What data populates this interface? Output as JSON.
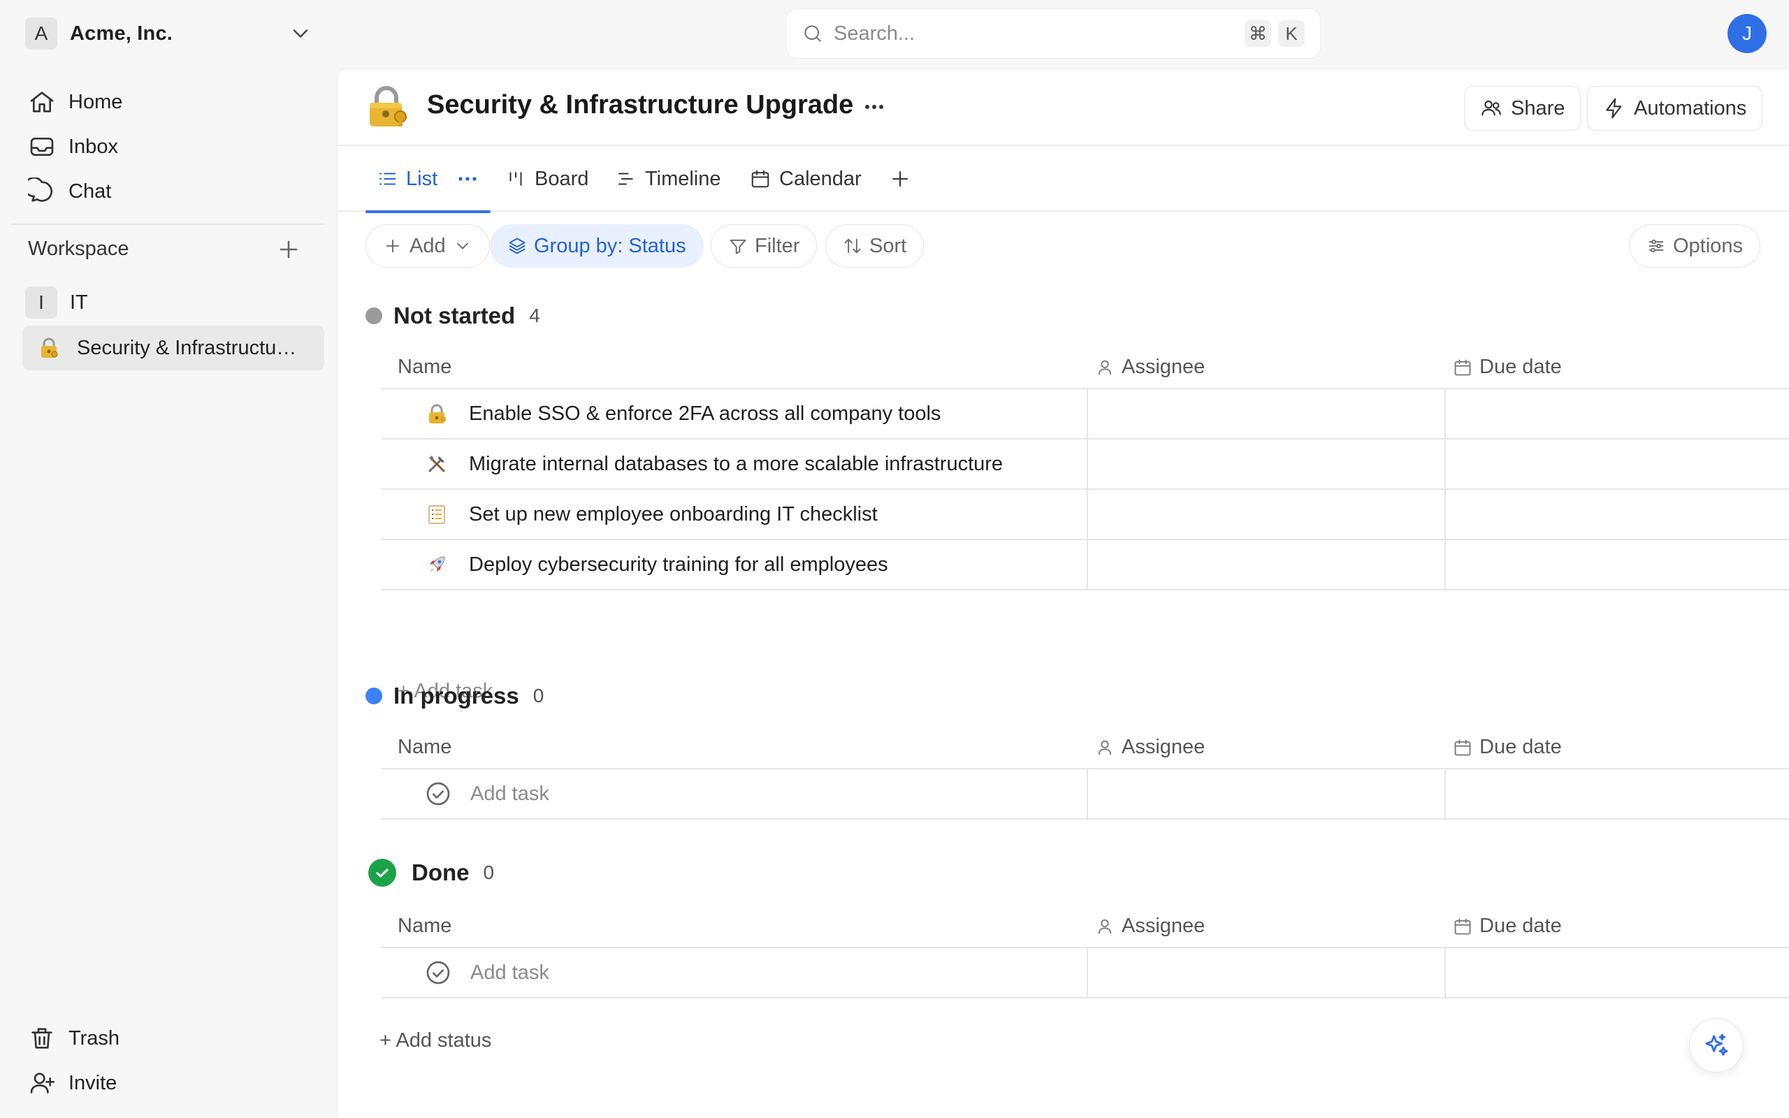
{
  "org": {
    "badge": "A",
    "name": "Acme, Inc."
  },
  "search": {
    "placeholder": "Search...",
    "shortcut_cmd": "⌘",
    "shortcut_key": "K"
  },
  "user": {
    "initial": "J"
  },
  "sidebar": {
    "nav": [
      {
        "label": "Home",
        "icon": "home-icon"
      },
      {
        "label": "Inbox",
        "icon": "inbox-icon"
      },
      {
        "label": "Chat",
        "icon": "chat-icon"
      }
    ],
    "workspace_title": "Workspace",
    "team": {
      "badge": "I",
      "label": "IT"
    },
    "project": {
      "label": "Security & Infrastructure Upgrade",
      "icon": "lock-key-icon"
    },
    "bottom": [
      {
        "label": "Trash",
        "icon": "trash-icon"
      },
      {
        "label": "Invite",
        "icon": "user-plus-icon"
      }
    ]
  },
  "page": {
    "title": "Security & Infrastructure Upgrade",
    "share_label": "Share",
    "automations_label": "Automations"
  },
  "tabs": [
    {
      "label": "List",
      "icon": "list-icon",
      "active": true
    },
    {
      "label": "Board",
      "icon": "board-icon"
    },
    {
      "label": "Timeline",
      "icon": "timeline-icon"
    },
    {
      "label": "Calendar",
      "icon": "calendar-icon"
    }
  ],
  "toolbar": {
    "add_label": "Add",
    "group_label": "Group by: Status",
    "filter_label": "Filter",
    "sort_label": "Sort",
    "options_label": "Options"
  },
  "columns": {
    "name": "Name",
    "assignee": "Assignee",
    "due_date": "Due date"
  },
  "groups": [
    {
      "title": "Not started",
      "count": "4",
      "color": "#9a9a9a",
      "tasks": [
        {
          "emoji": "lock-key-icon",
          "title": "Enable SSO & enforce 2FA across all company tools"
        },
        {
          "emoji": "tools-icon",
          "title": "Migrate internal databases to a more scalable infrastructure"
        },
        {
          "emoji": "checklist-icon",
          "title": "Set up new employee onboarding IT checklist"
        },
        {
          "emoji": "rocket-icon",
          "title": "Deploy cybersecurity training for all employees"
        }
      ],
      "add_task_label": "+ Add task"
    },
    {
      "title": "In progress",
      "count": "0",
      "color": "#3b82f6",
      "add_task_label": "Add task"
    },
    {
      "title": "Done",
      "count": "0",
      "color": "#1ca34a",
      "add_task_label": "Add task"
    }
  ],
  "add_status_label": "+ Add status",
  "colors": {
    "accent": "#2f6fe6",
    "done": "#1ca34a"
  }
}
